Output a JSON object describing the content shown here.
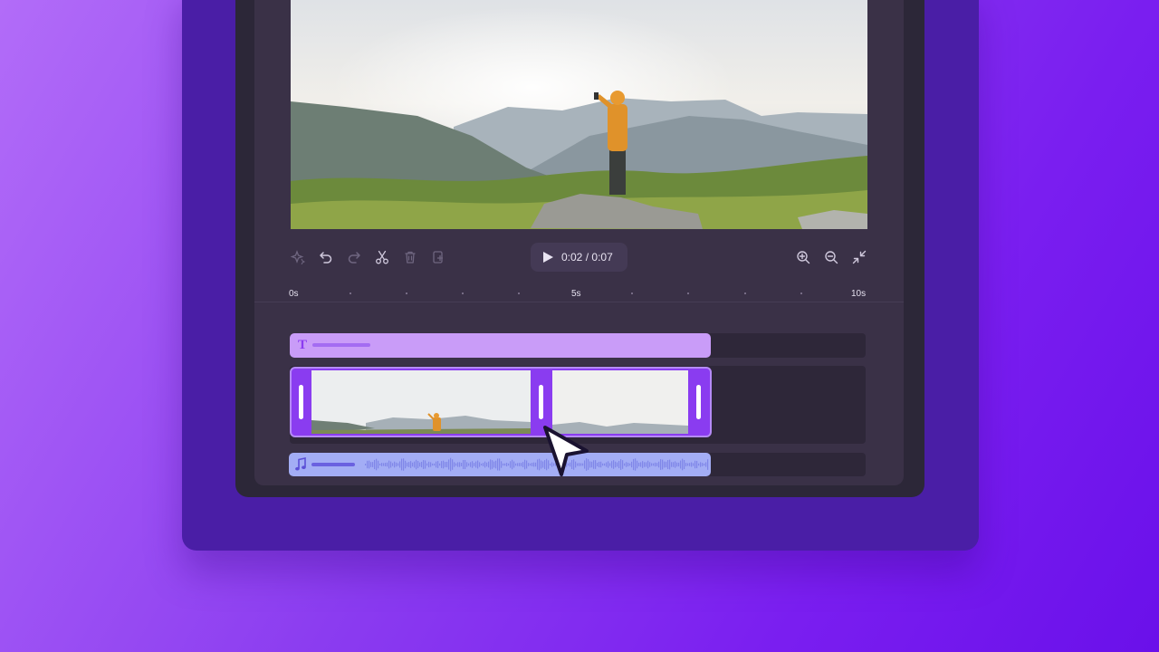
{
  "toolbar": {
    "tools": [
      {
        "name": "magic-icon",
        "enabled": false
      },
      {
        "name": "undo-icon",
        "enabled": true
      },
      {
        "name": "redo-icon",
        "enabled": false
      },
      {
        "name": "scissors-icon",
        "enabled": true
      },
      {
        "name": "trash-icon",
        "enabled": false
      },
      {
        "name": "duplicate-icon",
        "enabled": false
      }
    ],
    "current_time": "0:02",
    "separator": "/",
    "total_time": "0:07",
    "zoom_tools": [
      "zoom-in-icon",
      "zoom-out-icon",
      "fit-to-screen-icon"
    ]
  },
  "timeline": {
    "ruler_labels": [
      "0s",
      "5s",
      "10s"
    ]
  },
  "colors": {
    "background_accent": "#8b3cf0",
    "video_clip": "#8a3cf0",
    "text_clip": "#c99cf8",
    "audio_clip": "#a3adf5"
  }
}
